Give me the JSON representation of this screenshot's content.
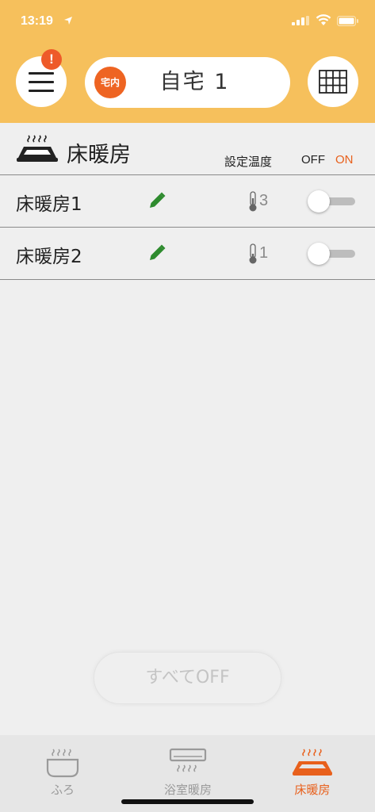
{
  "status_bar": {
    "time": "13:19"
  },
  "header": {
    "menu_badge": "!",
    "location_tag": "宅内",
    "location_name": "自宅 1"
  },
  "section": {
    "title": "床暖房",
    "col_setting": "設定温度",
    "col_off": "OFF",
    "col_on": "ON"
  },
  "rows": [
    {
      "name": "床暖房1",
      "temp": "3",
      "power": "off"
    },
    {
      "name": "床暖房2",
      "temp": "1",
      "power": "off"
    }
  ],
  "all_off_button": "すべてOFF",
  "tabs": [
    {
      "label": "ふろ",
      "icon": "bath-icon",
      "active": false
    },
    {
      "label": "浴室暖房",
      "icon": "bathroom-heater-icon",
      "active": false
    },
    {
      "label": "床暖房",
      "icon": "floor-heating-icon",
      "active": true
    }
  ],
  "colors": {
    "header_bg": "#f6c05c",
    "accent_orange": "#ee6422",
    "edit_green": "#2e8b2e",
    "inactive_text": "#9a9a9a"
  }
}
